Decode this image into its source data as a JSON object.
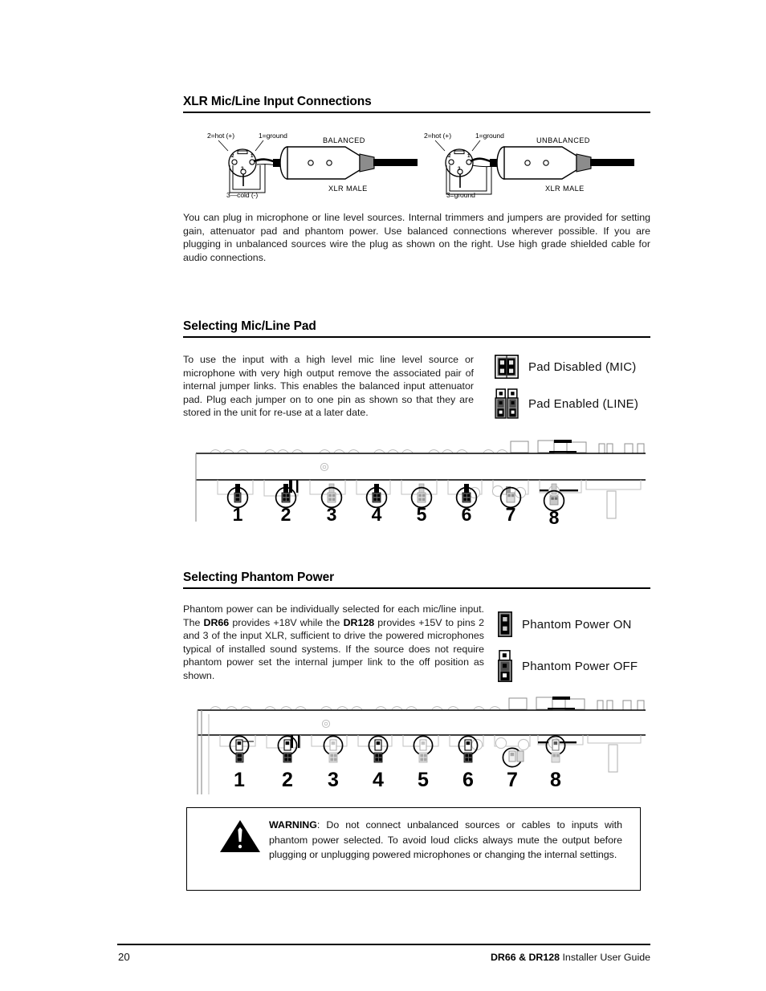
{
  "page": {
    "number": "20",
    "footer_title_bold": "DR66 & DR128",
    "footer_title_rest": " Installer User Guide"
  },
  "sections": [
    {
      "id": "xlr",
      "heading": "XLR Mic/Line Input Connections",
      "body": "You can plug in microphone or line level sources.  Internal trimmers and jumpers are provided for setting gain, attenuator pad and phantom power.  Use balanced connections wherever possible.  If you are plugging in unbalanced sources wire the plug as shown on the right.  Use high grade shielded cable for audio connections."
    },
    {
      "id": "pad",
      "heading": "Selecting Mic/Line Pad",
      "body": "To use the input with a high level mic line level source or microphone with very high output remove the associated pair of internal jumper links.  This enables the balanced input attenuator pad.  Plug each jumper on to one pin as shown so that they are stored in the unit for re-use at a later date."
    },
    {
      "id": "phantom",
      "heading": "Selecting Phantom Power",
      "body_1": "Phantom power can be individually selected for each mic/line input.   The ",
      "body_bold_1": "DR66",
      "body_2": " provides +18V while the ",
      "body_bold_2": "DR128",
      "body_3": " provides +15V to pins 2 and 3 of the input XLR, sufficient to drive the powered microphones typical of installed sound systems.  If the source does not require phantom power set the internal jumper link to the off position as shown."
    }
  ],
  "xlr_diagram": {
    "connectors": [
      {
        "type_label": "BALANCED",
        "pin_top_left": "2=hot (+)",
        "pin_top_right": "1=ground",
        "pin_bottom": "3—cold (-)",
        "connector_name": "XLR MALE",
        "pin_numbers": [
          "1",
          "2",
          "3"
        ]
      },
      {
        "type_label": "UNBALANCED",
        "pin_top_left": "2=hot (+)",
        "pin_top_right": "1=ground",
        "pin_bottom": "3=ground",
        "connector_name": "XLR MALE",
        "pin_numbers": [
          "1",
          "2",
          "3"
        ]
      }
    ]
  },
  "pad_legend": {
    "items": [
      {
        "icon": "jumper-block-pad-disabled-icon",
        "label": "Pad Disabled (MIC)"
      },
      {
        "icon": "jumper-block-pad-enabled-icon",
        "label": "Pad Enabled (LINE)"
      }
    ]
  },
  "phantom_legend": {
    "items": [
      {
        "icon": "jumper-block-phantom-on-icon",
        "label": "Phantom Power ON"
      },
      {
        "icon": "jumper-block-phantom-off-icon",
        "label": "Phantom Power OFF"
      }
    ]
  },
  "pcb_pad": {
    "caption_numbers": [
      "1",
      "2",
      "3",
      "4",
      "5",
      "6",
      "7",
      "8"
    ]
  },
  "pcb_phantom": {
    "caption_numbers": [
      "1",
      "2",
      "3",
      "4",
      "5",
      "6",
      "7",
      "8"
    ]
  },
  "warning": {
    "word": "WARNING",
    "text": ":  Do not connect unbalanced sources or cables to inputs with phantom power selected.   To avoid loud clicks always mute the output before plugging or unplugging powered microphones or changing the internal settings."
  },
  "colors": {
    "ink": "#000000",
    "body_ink": "#1a1a1a",
    "pcb_outline": "#bfbfbf",
    "pcb_dark": "#000000",
    "jumper_gray": "#808080",
    "page_bg": "#ffffff"
  }
}
